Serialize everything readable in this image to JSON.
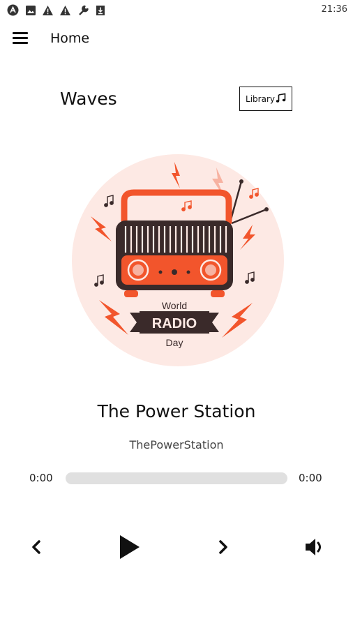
{
  "status_bar": {
    "time": "21:36",
    "icons": [
      "app-notification-icon",
      "image-icon",
      "warning-icon",
      "warning-icon",
      "wrench-icon",
      "download-icon"
    ]
  },
  "header": {
    "title": "Home",
    "menu_icon": "hamburger-menu-icon"
  },
  "brand": {
    "name": "Waves"
  },
  "library_button": {
    "label": "Library",
    "icon": "music-note-icon"
  },
  "artwork": {
    "line1": "World",
    "line2": "RADIO",
    "line3": "Day",
    "colors": {
      "accent": "#f2552c",
      "dark": "#3a2a2a",
      "background": "#fde9e4"
    }
  },
  "now_playing": {
    "station_name": "The Power Station",
    "station_id": "ThePowerStation"
  },
  "player": {
    "current_time": "0:00",
    "duration": "0:00",
    "progress": 0,
    "controls": [
      "previous-icon",
      "play-icon",
      "next-icon",
      "volume-icon"
    ]
  }
}
